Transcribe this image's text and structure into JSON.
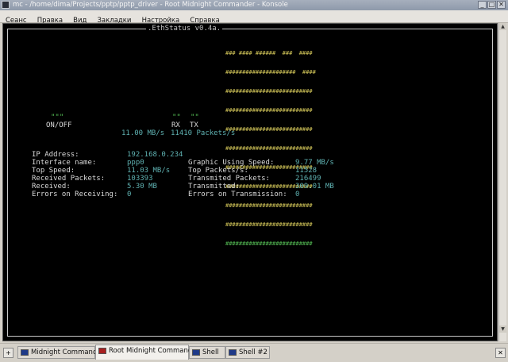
{
  "window": {
    "title": "mc - /home/dima/Projects/pptp/pptp_driver - Root Midnight Commander - Konsole",
    "buttons": [
      "_",
      "□",
      "✕"
    ]
  },
  "menu": [
    "Сеанс",
    "Правка",
    "Вид",
    "Закладки",
    "Настройка",
    "Справка"
  ],
  "terminal": {
    "frame_title": ".EthStatus v0.4a.",
    "logo_lines": [
      "### #### ######  ###  ####",
      "#####################  ####",
      "##########################",
      "##########################",
      "##########################",
      "##########################",
      "##########################",
      "##########################",
      "##########################",
      "##########################"
    ],
    "logo_green": "##########################",
    "indicator": {
      "on_off_marks": "\"\"\"",
      "on_off_label": "ON/OFF",
      "rx_marks": "\"\"",
      "rx_label": "RX",
      "tx_marks": "\"\"",
      "tx_label": "TX",
      "speed": "11.00 MB/s",
      "packets": "11410 Packets/s"
    },
    "stats_left": [
      {
        "label": "IP Address:",
        "value": "192.168.0.234"
      },
      {
        "label": "Interface name:",
        "value": "ppp0"
      },
      {
        "label": "Top Speed:",
        "value": "11.03 MB/s"
      },
      {
        "label": "Received Packets:",
        "value": "103393"
      },
      {
        "label": "Received:",
        "value": "5.30 MB"
      },
      {
        "label": "Errors on Receiving:",
        "value": "0"
      }
    ],
    "stats_right": [
      {
        "label": "Graphic Using Speed:",
        "value": "9.77 MB/s"
      },
      {
        "label": "Top Packets/s:",
        "value": "11528"
      },
      {
        "label": "Transmited Packets:",
        "value": "216499"
      },
      {
        "label": "Transmitted:",
        "value": "309.01 MB"
      },
      {
        "label": "Errors on Transmission:",
        "value": "0"
      }
    ]
  },
  "tabs": [
    {
      "label": "Midnight Commander"
    },
    {
      "label": "Root Midnight Commander"
    },
    {
      "label": "Shell"
    },
    {
      "label": "Shell #2"
    }
  ],
  "colors": {
    "terminal_bg": "#000000",
    "label_text": "#d8d8d8",
    "value_text": "#5fb2b2",
    "indicator_marks": "#56c056",
    "logo_yellow": "#d6c95a",
    "logo_green": "#55bf55"
  }
}
